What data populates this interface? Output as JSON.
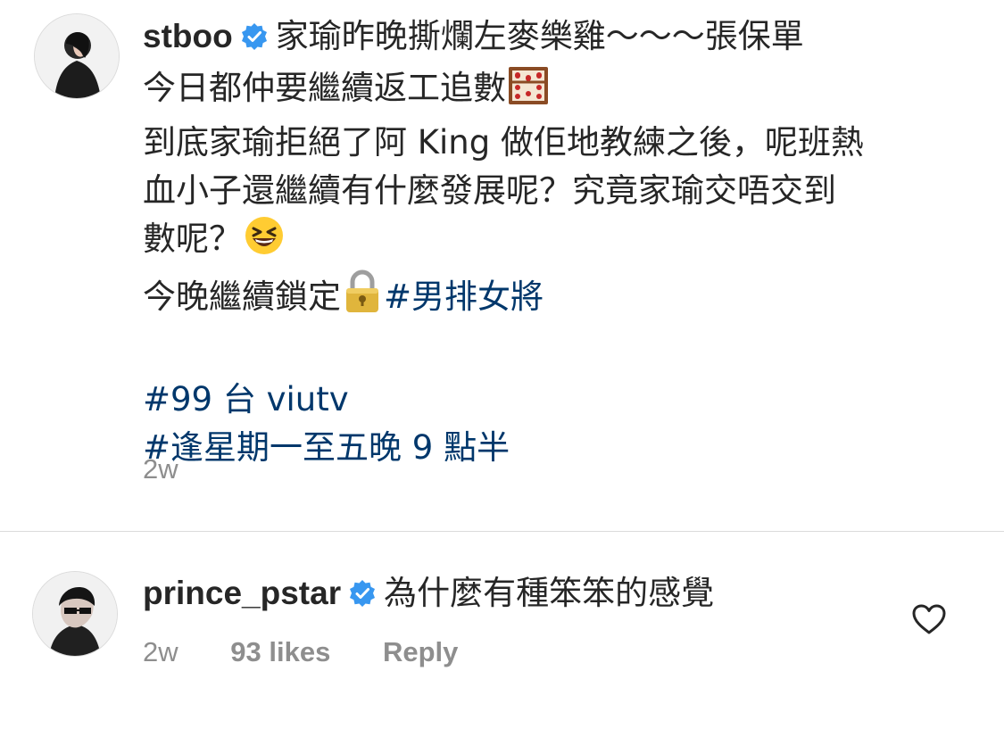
{
  "post": {
    "username": "stboo",
    "lines": [
      "家瑜昨晚撕爛左麥樂雞～～～張保單",
      "今日都仲要繼續返工追數",
      "到底家瑜拒絕了阿 King 做佢地教練之後，呢班熱",
      "血小子還繼續有什麼發展呢？究竟家瑜交唔交到",
      "數呢？",
      "今晚繼續鎖定"
    ],
    "hashtags": [
      "#男排女將",
      "#99 台 viutv",
      "#逢星期一至五晚 9 點半"
    ],
    "emoji": [
      "abacus",
      "grinning-squinting-face",
      "lock"
    ],
    "time": "2w"
  },
  "comment": {
    "username": "prince_pstar",
    "text": "為什麼有種笨笨的感覺",
    "time": "2w",
    "likes": "93 likes",
    "reply": "Reply",
    "icon": "heart-outline"
  },
  "colors": {
    "text": "#262626",
    "secondary": "#8e8e8e",
    "hashtag": "#00376b",
    "verified": "#3897f0",
    "divider": "#dbdbdb"
  }
}
